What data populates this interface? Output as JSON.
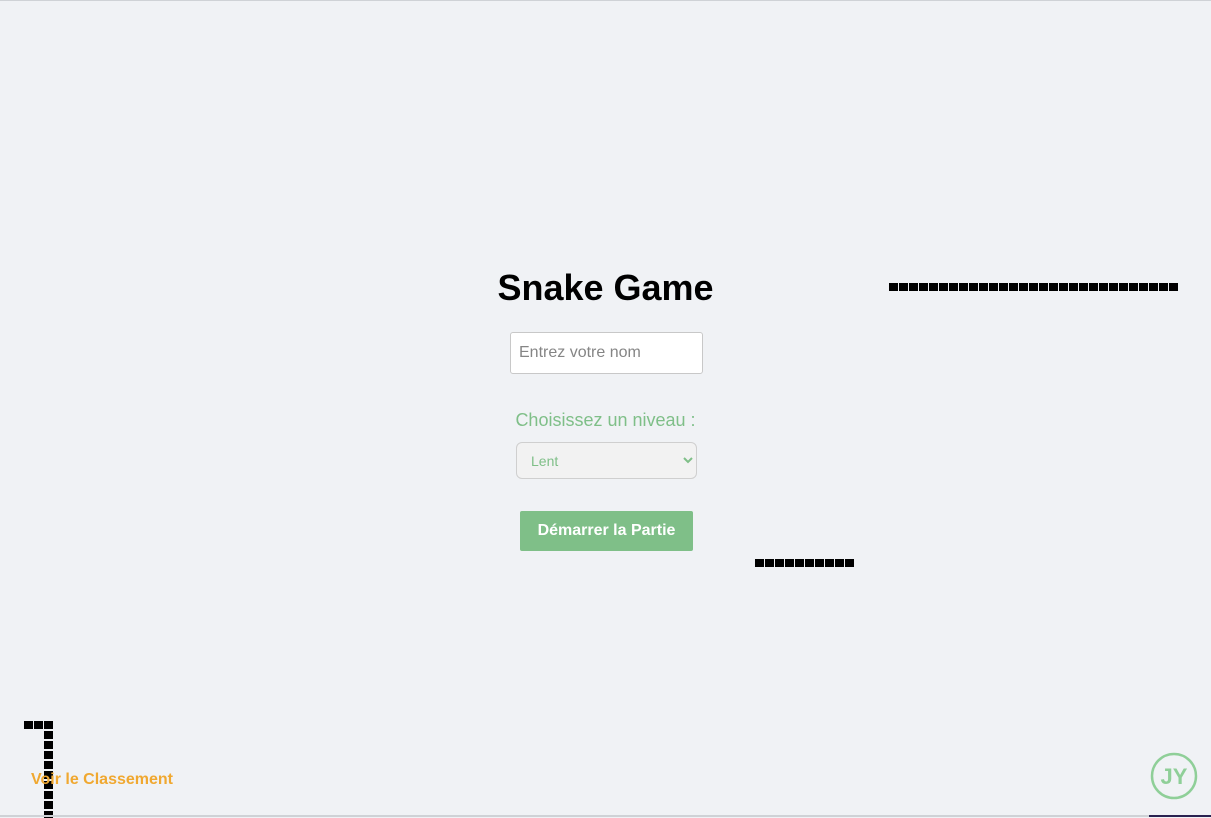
{
  "game": {
    "title": "Snake Game",
    "name_placeholder": "Entrez votre nom",
    "name_value": "",
    "level_label": "Choisissez un niveau :",
    "level_selected": "Lent",
    "start_label": "Démarrer la Partie",
    "ranking_label": "Voir le Classement"
  },
  "logo": {
    "icon": "jy-logo-icon",
    "text": "JY",
    "color": "#8fcf98"
  },
  "colors": {
    "background": "#f0f2f5",
    "accent_green": "#7fbf88",
    "ranking_orange": "#f0a830",
    "snake": "#000000"
  }
}
